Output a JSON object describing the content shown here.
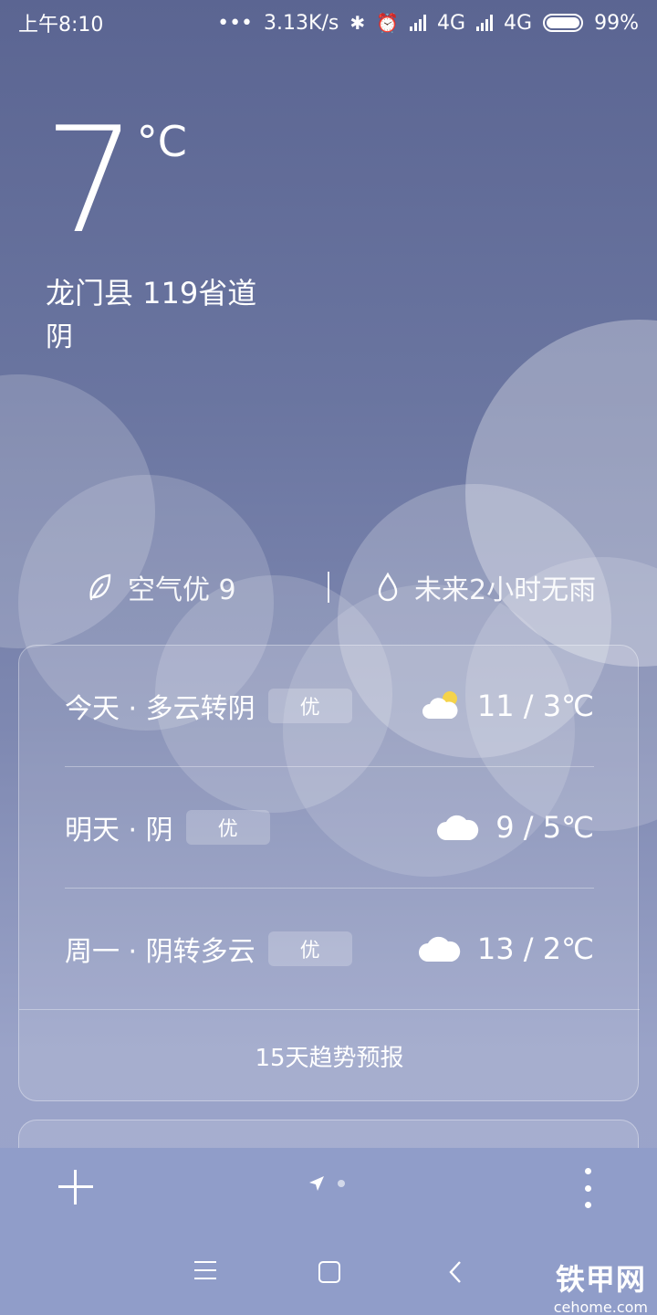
{
  "status_bar": {
    "time": "上午8:10",
    "dots": "•••",
    "speed": "3.13K/s",
    "net1": "4G",
    "net2": "4G",
    "battery": "99%"
  },
  "current": {
    "temperature": "7",
    "unit": "°C",
    "location": "龙门县 119省道",
    "condition": "阴"
  },
  "info": {
    "air_quality": "空气优 9",
    "rain": "未来2小时无雨"
  },
  "forecast": [
    {
      "day": "今天 · 多云转阴",
      "aqi": "优",
      "icon": "partly-cloudy-icon",
      "temp": "11 / 3℃"
    },
    {
      "day": "明天 · 阴",
      "aqi": "优",
      "icon": "cloud-icon",
      "temp": "9 / 5℃"
    },
    {
      "day": "周一 · 阴转多云",
      "aqi": "优",
      "icon": "cloud-icon",
      "temp": "13 / 2℃"
    }
  ],
  "trend_button": "15天趋势预报",
  "watermark": {
    "logo": "铁甲网",
    "url": "cehome.com"
  },
  "colors": {
    "bg_top": "#5b6592",
    "bg_bottom": "#9ba4cc",
    "toolbar": "#909dc9",
    "sun": "#f5d34a"
  }
}
